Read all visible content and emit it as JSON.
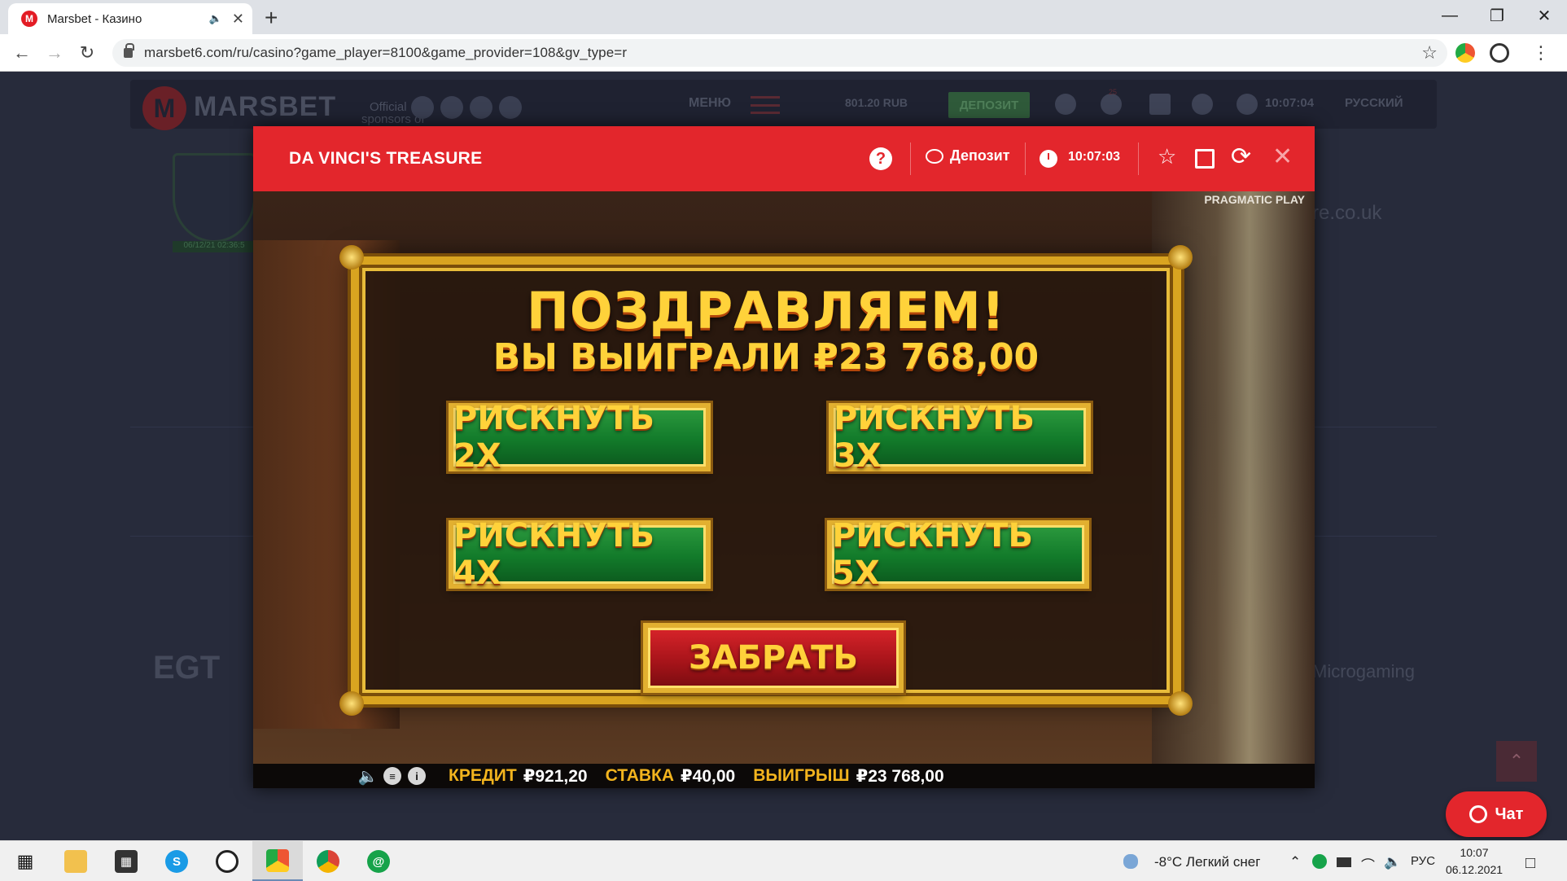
{
  "browser": {
    "tab_title": "Marsbet - Казино",
    "tab_favicon": "M",
    "url": "marsbet6.com/ru/casino?game_player=8100&game_provider=108&gv_type=r"
  },
  "site": {
    "logo_letter": "M",
    "logo_text": "MARSBET",
    "sponsors_line1": "Official",
    "sponsors_line2": "sponsors of",
    "menu_label": "МЕНЮ",
    "balance": "801.20 RUB",
    "deposit_label": "ДЕПОЗИТ",
    "notifications_count": "25",
    "time": "10:07:04",
    "language": "РУССКИЙ",
    "license_date": "06/12/21 02:36:5",
    "gamecare": "re.co.uk",
    "provider_egt": "EGT",
    "provider_microgaming": "Microgaming",
    "chat_label": "Чат"
  },
  "modal": {
    "title": "DA VINCI'S TREASURE",
    "deposit_label": "Депозит",
    "time": "10:07:03"
  },
  "game": {
    "provider": "PRAGMATIC PLAY",
    "congrats": "ПОЗДРАВЛЯЕМ!",
    "won_text": "ВЫ ВЫИГРАЛИ ₽23 768,00",
    "gamble_2x": "РИСКНУТЬ 2X",
    "gamble_3x": "РИСКНУТЬ 3X",
    "gamble_4x": "РИСКНУТЬ 4X",
    "gamble_5x": "РИСКНУТЬ 5X",
    "collect": "ЗАБРАТЬ",
    "credit_label": "КРЕДИТ",
    "credit_value": "₽921,20",
    "bet_label": "СТАВКА",
    "bet_value": "₽40,00",
    "win_label": "ВЫИГРЫШ",
    "win_value": "₽23 768,00"
  },
  "taskbar": {
    "weather": "-8°C  Легкий снег",
    "lang": "РУС",
    "time": "10:07",
    "date": "06.12.2021"
  },
  "colors": {
    "brand_red": "#e3262c",
    "gold": "#ffd23a",
    "button_green": "#127a2a"
  }
}
